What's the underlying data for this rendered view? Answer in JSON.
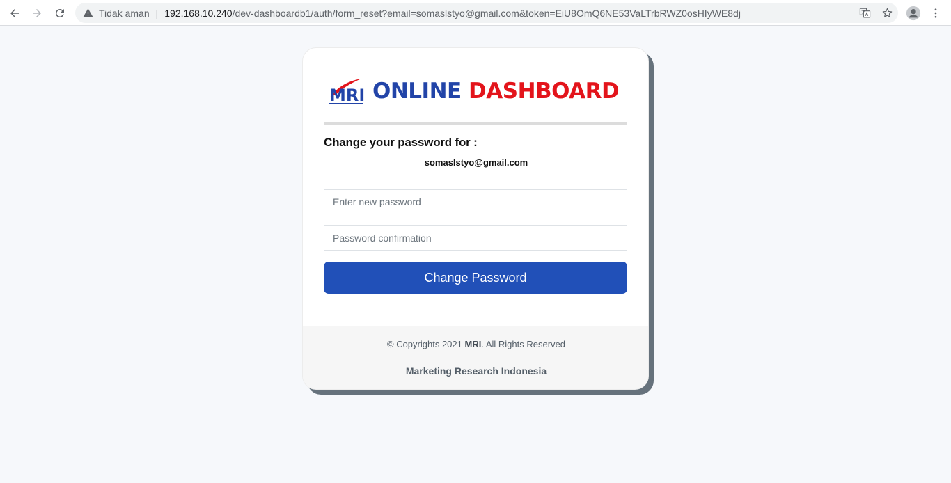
{
  "browser": {
    "security_label": "Tidak aman",
    "separator": "|",
    "url_host": "192.168.10.240",
    "url_path": "/dev-dashboardb1/auth/form_reset?email=somaslstyo@gmail.com&token=EiU8OmQ6NE53VaLTrbRWZ0osHIyWE8dj",
    "icons": [
      "back-icon",
      "forward-icon",
      "reload-icon",
      "warning-icon",
      "translate-icon",
      "star-icon",
      "profile-icon",
      "menu-icon"
    ]
  },
  "logo": {
    "mark": "MRI",
    "word1": "ONLINE",
    "word2": "DASHBOARD",
    "colors": {
      "blue": "#2244a8",
      "red": "#e3141b"
    }
  },
  "form": {
    "heading": "Change your password for :",
    "email": "somaslstyo@gmail.com",
    "new_password_placeholder": "Enter new password",
    "confirm_password_placeholder": "Password confirmation",
    "submit_label": "Change Password",
    "accent": "#2150b8"
  },
  "footer": {
    "copyright_prefix": "© Copyrights 2021 ",
    "copyright_brand": "MRI",
    "copyright_suffix": ". All Rights Reserved",
    "company": "Marketing Research Indonesia"
  }
}
